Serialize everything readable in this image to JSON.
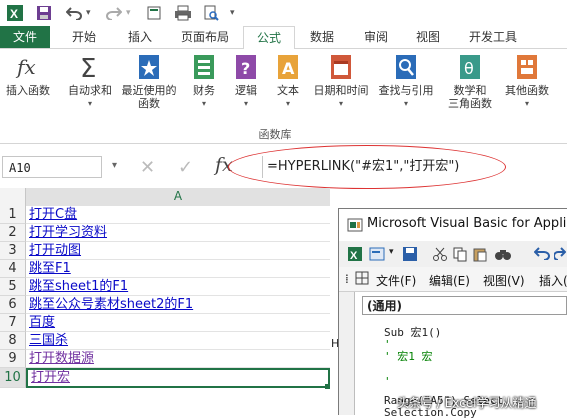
{
  "colors": {
    "accent": "#217346",
    "link": "#0a0ac8",
    "visited_link": "#7030a0",
    "annotation": "#d33333"
  },
  "qat": {
    "icons": [
      "excel-logo-icon",
      "save-icon",
      "undo-icon",
      "redo-icon",
      "dropdown-icon",
      "new-icon",
      "print-icon",
      "print-preview-icon",
      "dropdown-icon"
    ]
  },
  "ribbon": {
    "tabs": [
      "文件",
      "开始",
      "插入",
      "页面布局",
      "公式",
      "数据",
      "审阅",
      "视图",
      "开发工具"
    ],
    "active_tab": "公式",
    "buttons": [
      {
        "label": "插入函数",
        "icon": "fx-icon"
      },
      {
        "label": "自动求和",
        "icon": "sigma-icon"
      },
      {
        "label": "最近使用的",
        "label2": "函数",
        "icon": "star-book-icon"
      },
      {
        "label": "财务",
        "icon": "finance-book-icon"
      },
      {
        "label": "逻辑",
        "icon": "logic-book-icon"
      },
      {
        "label": "文本",
        "icon": "text-book-icon"
      },
      {
        "label": "日期和时间",
        "icon": "calendar-book-icon"
      },
      {
        "label": "查找与引用",
        "icon": "lookup-book-icon"
      },
      {
        "label": "数学和",
        "label2": "三角函数",
        "icon": "theta-book-icon"
      },
      {
        "label": "其他函数",
        "icon": "more-book-icon"
      }
    ],
    "group_label": "函数库"
  },
  "formula_bar": {
    "name_box": "A10",
    "fx": "fx",
    "formula": "=HYPERLINK(\"#宏1\",\"打开宏\")"
  },
  "sheet": {
    "column": "A",
    "rows": [
      {
        "num": "1",
        "text": "打开C盘",
        "visited": false
      },
      {
        "num": "2",
        "text": "打开学习资料",
        "visited": false
      },
      {
        "num": "3",
        "text": "打开动图",
        "visited": false
      },
      {
        "num": "4",
        "text": "跳至F1",
        "visited": false
      },
      {
        "num": "5",
        "text": "跳至sheet1的F1",
        "visited": false
      },
      {
        "num": "6",
        "text": "跳至公众号素材sheet2的F1",
        "visited": false
      },
      {
        "num": "7",
        "text": "百度",
        "visited": false
      },
      {
        "num": "8",
        "text": "三国杀",
        "visited": false
      },
      {
        "num": "9",
        "text": "打开数据源",
        "visited": true
      },
      {
        "num": "10",
        "text": "打开宏",
        "visited": true
      }
    ],
    "selected_row": "10",
    "overflow_char": "H"
  },
  "vba": {
    "title": "Microsoft Visual Basic for Applicat",
    "menus": [
      "文件(F)",
      "编辑(E)",
      "视图(V)",
      "插入("
    ],
    "combo": "(通用)",
    "code_lines": [
      {
        "text": "Sub 宏1()",
        "comment": false
      },
      {
        "text": "'",
        "comment": true
      },
      {
        "text": "' 宏1 宏",
        "comment": true
      },
      {
        "text": "'",
        "comment": true
      },
      {
        "text": "Range(\"A5\").Select",
        "comment": false
      },
      {
        "text": "Selection.Copy",
        "comment": false
      }
    ]
  },
  "watermark": "头条号 / Excel学习从精通"
}
